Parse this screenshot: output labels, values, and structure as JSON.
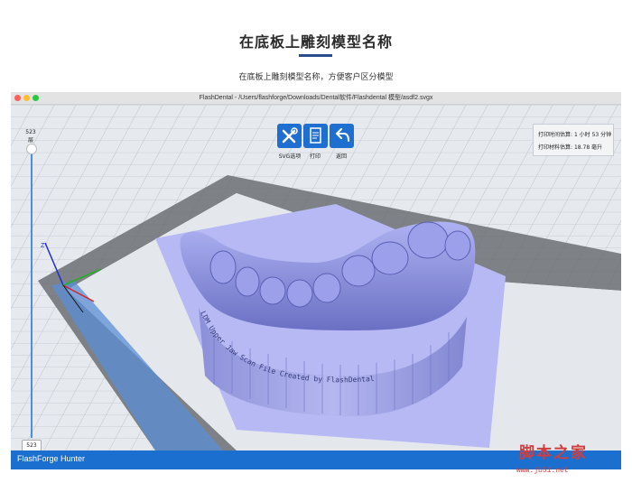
{
  "header": {
    "title": "在底板上雕刻模型名称",
    "subtitle": "在底板上雕刻模型名称，方便客户区分模型"
  },
  "window": {
    "title": "FlashDental - /Users/flashforge/Downloads/Dental软件/Flashdental 模型/asdf2.svgx",
    "traffic_lights": [
      "#fe5f57",
      "#febc2e",
      "#28c840"
    ]
  },
  "toolbar": {
    "items": [
      {
        "label": "SVG选项",
        "icon": "tools-icon"
      },
      {
        "label": "打印",
        "icon": "print-file-icon"
      },
      {
        "label": "返回",
        "icon": "back-arrow-icon"
      }
    ],
    "accent": "#1f6fd1"
  },
  "info_panel": {
    "time_label": "打印时间估算:",
    "time_value": "1 小时 53 分钟",
    "material_label": "打印材料估算:",
    "material_value": "18.78 毫升"
  },
  "layer_slider": {
    "top_value": "523",
    "top_label": "层",
    "bottom_value": "523"
  },
  "axes": {
    "z_label": "Z"
  },
  "model": {
    "engraved_text": "LDM Upper Jaw Scan File Created by FlashDental"
  },
  "statusbar": {
    "text": "FlashForge Hunter"
  },
  "watermark": {
    "line1": "脚本之家",
    "line2": "www.jb51.net"
  }
}
